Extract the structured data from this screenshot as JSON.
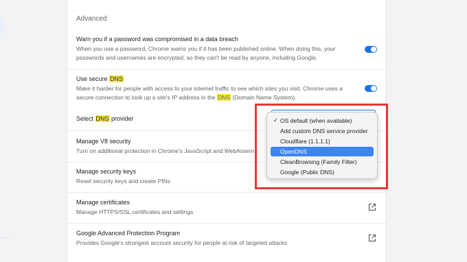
{
  "section": {
    "title": "Advanced"
  },
  "password_warn": {
    "title": "Warn you if a password was compromised in a data breach",
    "desc": "When you use a password, Chrome warns you if it has been published online. When doing this, your passwords and usernames are encrypted, so they can't be read by anyone, including Google.",
    "enabled": true
  },
  "secure_dns": {
    "title_pre": "Use secure ",
    "title_hl": "DNS",
    "desc_a": "Make it harder for people with access to your internet traffic to see which sites you visit. Chrome uses a secure connection to look up a site's IP address in the ",
    "desc_hl": "DNS",
    "desc_b": " (Domain Name System).",
    "enabled": true
  },
  "dns_provider": {
    "label_pre": "Select ",
    "label_hl": "DNS",
    "label_post": " provider"
  },
  "dropdown": {
    "options": [
      "OS default (when available)",
      "Add custom DNS service provider",
      "Cloudflare (1.1.1.1)",
      "OpenDNS",
      "CleanBrowsing (Family Filter)",
      "Google (Public DNS)"
    ],
    "checked": "OS default (when available)",
    "highlighted": "OpenDNS"
  },
  "v8": {
    "title": "Manage V8 security",
    "desc": "Turn on additional protection in Chrome's JavaScript and WebAssem"
  },
  "security_keys": {
    "title": "Manage security keys",
    "desc": "Reset security keys and create PINs"
  },
  "certificates": {
    "title": "Manage certificates",
    "desc": "Manage HTTPS/SSL certificates and settings"
  },
  "advanced_protection": {
    "title": "Google Advanced Protection Program",
    "desc": "Provides Google's strongest account security for people at risk of targeted attacks"
  },
  "colors": {
    "accent": "#1a73e8",
    "highlight": "#f7e840",
    "annotation_border": "#e53935",
    "dropdown_selected": "#3d84f5"
  }
}
